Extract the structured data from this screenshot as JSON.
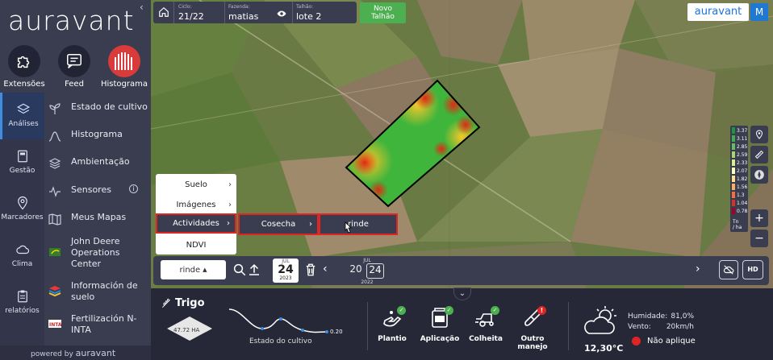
{
  "brand": {
    "logo_text": "auravant",
    "badge_text": "auravant",
    "user_initial": "M",
    "powered_prefix": "powered by",
    "powered_brand": "auravant"
  },
  "top_apps": [
    {
      "label": "Extensões",
      "icon": "puzzle-icon"
    },
    {
      "label": "Feed",
      "icon": "feed-icon"
    },
    {
      "label": "Histograma",
      "icon": "histogram-icon"
    }
  ],
  "rail": [
    {
      "label": "Análises",
      "icon": "layers-icon"
    },
    {
      "label": "Gestão",
      "icon": "book-icon"
    },
    {
      "label": "Marcadores",
      "icon": "marker-icon"
    },
    {
      "label": "Clima",
      "icon": "cloud-icon"
    },
    {
      "label": "relatórios",
      "icon": "report-icon"
    }
  ],
  "menu": [
    {
      "label": "Estado de cultivo"
    },
    {
      "label": "Histograma"
    },
    {
      "label": "Ambientação"
    },
    {
      "label": "Sensores"
    },
    {
      "label": "Meus Mapas"
    },
    {
      "label": "John Deere Operations Center"
    },
    {
      "label": "Información de suelo"
    },
    {
      "label": "Fertilización N-INTA"
    }
  ],
  "topbar": {
    "ciclo_label": "Ciclo:",
    "ciclo_value": "21/22",
    "fazenda_label": "Fazenda:",
    "fazenda_value": "matias",
    "talhao_label": "Talhão:",
    "talhao_value": "lote 2",
    "novo_line1": "Novo",
    "novo_line2": "Talhão"
  },
  "legend": {
    "values": [
      "3.37",
      "3.11",
      "2.85",
      "2.59",
      "2.33",
      "2.07",
      "1.82",
      "1.56",
      "1.3",
      "1.04",
      "0.78"
    ],
    "colors": [
      "#1a9641",
      "#3fae4b",
      "#66bd63",
      "#a6d96a",
      "#d9ef8b",
      "#ffffbf",
      "#fee08b",
      "#fdae61",
      "#f46d43",
      "#d73027",
      "#a50026"
    ],
    "unit_line1": "Tn",
    "unit_line2": "/ ha"
  },
  "map_menu": {
    "col1": [
      {
        "label": "Suelo",
        "has_chevron": true
      },
      {
        "label": "Imágenes",
        "has_chevron": true
      },
      {
        "label": "Actividades",
        "has_chevron": true
      },
      {
        "label": "NDVI",
        "has_chevron": false
      }
    ],
    "col2": [
      {
        "label": "Cosecha",
        "has_chevron": true
      }
    ],
    "col3": [
      {
        "label": "rinde",
        "has_chevron": false
      }
    ]
  },
  "controls": {
    "layer_value": "rinde",
    "date_month": "JUL",
    "date_day": "24",
    "date_year": "2023",
    "range_month": "JUL",
    "range_day1": "20",
    "range_day2": "24",
    "range_year": "2022",
    "hd_label": "HD"
  },
  "crop": {
    "name": "Trigo",
    "area": "47.72 HA",
    "growth_value": "0.20",
    "growth_label": "Estado do cultivo"
  },
  "activities": [
    {
      "label": "Plantio",
      "status": "check"
    },
    {
      "label": "Aplicação",
      "status": "check"
    },
    {
      "label": "Colheita",
      "status": "check"
    },
    {
      "label": "Outro manejo",
      "status": "alert"
    }
  ],
  "weather": {
    "temperature": "12,30°C",
    "humidity_label": "Humidade:",
    "humidity_value": "81,0%",
    "wind_label": "Vento:",
    "wind_value": "20km/h",
    "apply_status": "Não aplique",
    "apply_color": "#e02424"
  }
}
